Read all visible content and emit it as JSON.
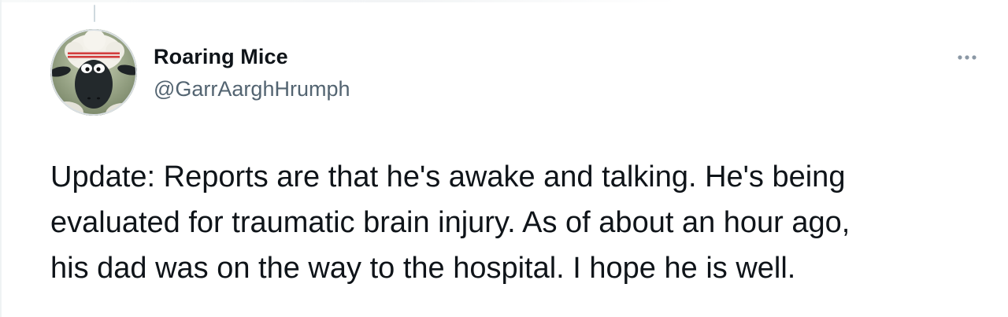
{
  "tweet": {
    "author": {
      "display_name": "Roaring Mice",
      "handle": "@GarrAarghHrumph",
      "avatar_icon": "sheep-avatar-icon"
    },
    "more_icon": "more-options-icon",
    "text": "Update: Reports are that he's awake and talking. He's being\nevaluated for traumatic brain injury. As of about an hour ago,\nhis dad was on the way to the hospital. I hope he is well."
  },
  "colors": {
    "text_primary": "#0f1419",
    "text_secondary": "#536471",
    "icon_muted": "#8b98a5",
    "thread_line": "#cfd9de"
  }
}
